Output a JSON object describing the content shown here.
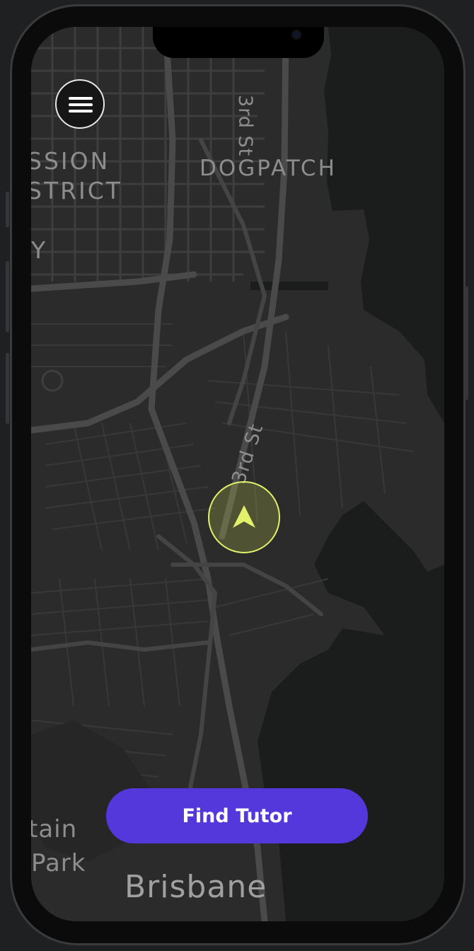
{
  "app": {
    "accent_color": "#5438dc",
    "location_marker_color": "#e3f06a"
  },
  "header": {
    "menu_icon": "hamburger-menu-icon"
  },
  "map": {
    "labels": {
      "mission_line1": "SSION",
      "mission_line2": "STRICT",
      "partial_y": "Y",
      "dogpatch": "DOGPATCH",
      "street_3rd_top": "3rd St",
      "street_3rd_mid": "3rd St",
      "park_line1": "tain",
      "park_line2": "Park",
      "brisbane": "Brisbane"
    },
    "location_icon": "navigation-arrow-icon"
  },
  "actions": {
    "find_tutor_label": "Find Tutor"
  }
}
